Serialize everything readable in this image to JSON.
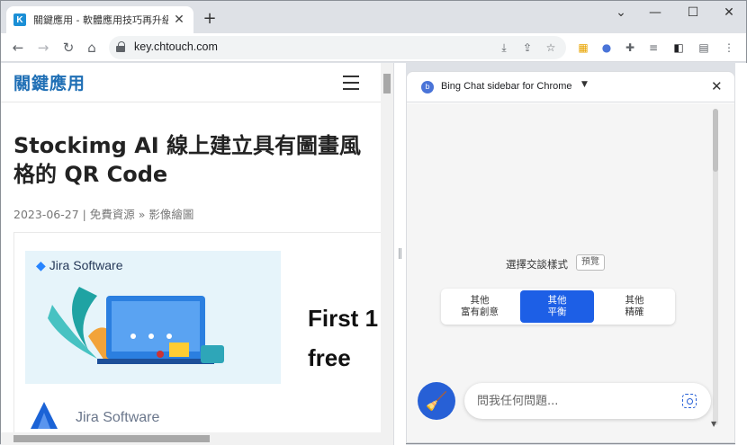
{
  "tab": {
    "title": "關鍵應用 - 軟體應用技巧再升級",
    "favicon_letter": "K"
  },
  "window_controls": {
    "minimize": "⌄",
    "min": "—",
    "max": "☐",
    "close": "✕"
  },
  "toolbar": {
    "url": "key.chtouch.com"
  },
  "site": {
    "logo": "關鍵應用"
  },
  "article": {
    "title": "Stockimg AI 線上建立具有圖畫風格的 QR Code",
    "meta": "2023-06-27 | 免費資源 » 影像繪圖",
    "banner_logo": "Jira Software",
    "big_line1": "First 1",
    "big_line2": "free",
    "product_name": "Jira Software"
  },
  "sidebar": {
    "title": "Bing Chat sidebar for Chrome",
    "style_label": "選擇交談樣式",
    "preview_badge": "預覽",
    "styles": [
      {
        "line1": "其他",
        "line2": "富有創意",
        "active": false
      },
      {
        "line1": "其他",
        "line2": "平衡",
        "active": true
      },
      {
        "line1": "其他",
        "line2": "精確",
        "active": false
      }
    ],
    "ask_placeholder": "問我任何問題..."
  },
  "colors": {
    "accent": "#1d5fe6",
    "brand": "#1f6fb5"
  }
}
